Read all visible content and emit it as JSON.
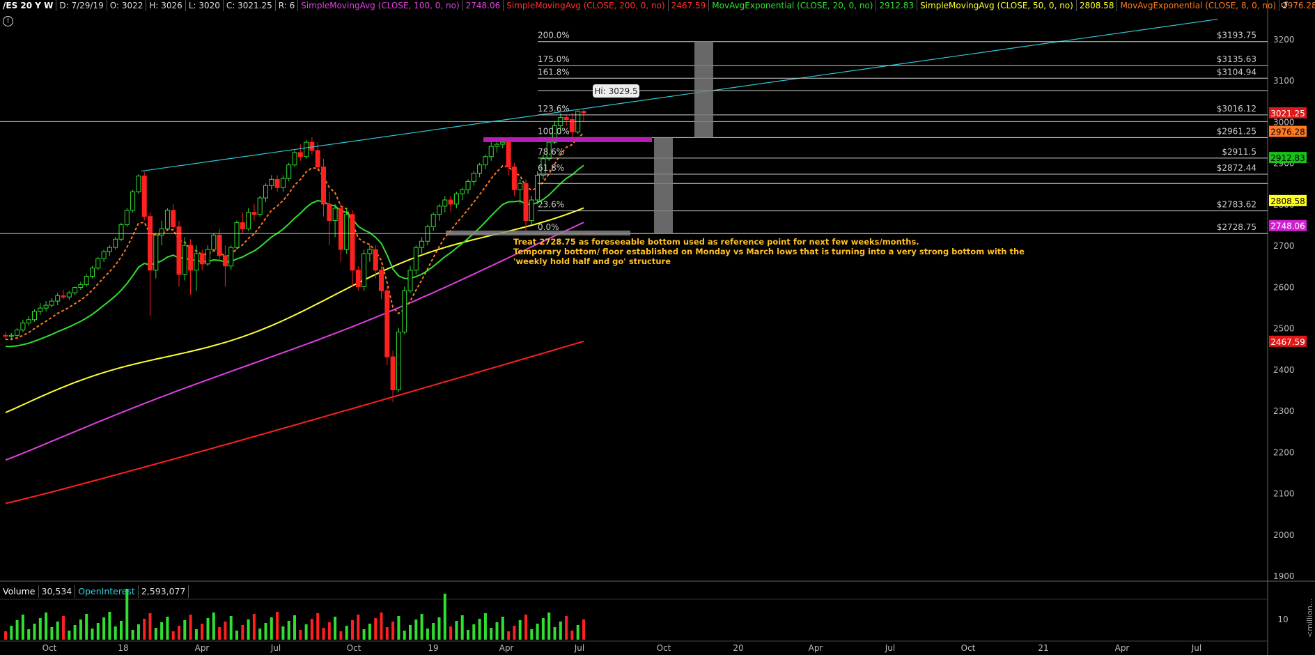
{
  "header": {
    "symbol": "/ES 20 Y W",
    "date": "D: 7/29/19",
    "open": "O: 3022",
    "high": "H: 3026",
    "low": "L: 3020",
    "close": "C: 3021.25",
    "range": "R: 6",
    "studies": [
      {
        "label": "SimpleMovingAvg (CLOSE, 100, 0, no)",
        "value": "2748.06",
        "color": "#e040e0"
      },
      {
        "label": "SimpleMovingAvg (CLOSE, 200, 0, no)",
        "value": "2467.59",
        "color": "#ff2020"
      },
      {
        "label": "MovAvgExponential (CLOSE, 20, 0, no)",
        "value": "2912.83",
        "color": "#30e030"
      },
      {
        "label": "SimpleMovingAvg (CLOSE, 50, 0, no)",
        "value": "2808.58",
        "color": "#ffff30"
      },
      {
        "label": "MovAvgExponential (CLOSE, 8, 0, no)",
        "value": "2976.28",
        "color": "#ff7a20"
      }
    ]
  },
  "annotation": {
    "lines": [
      "Treat 2728.75 as foreseeable bottom used as reference point for next few weeks/months.",
      "Temporary bottom/ floor established on Monday vs March lows that is turning into a very strong bottom with the",
      "'weekly hold half and go' structure"
    ],
    "color": "#ffc020"
  },
  "hi_bubble": "Hi: 3029.5",
  "volume_panel": {
    "volume_label": "Volume",
    "volume_value": "30,534",
    "oi_label": "OpenInterest",
    "oi_value": "2,593,077",
    "axis_unit": "<million...",
    "axis_tick": "10"
  },
  "chart_data": {
    "type": "candlestick",
    "instrument": "/ES",
    "timeframe": "weekly",
    "price_axis": {
      "range": [
        1865,
        3235
      ],
      "ticks": [
        3200,
        3100,
        3000,
        2900,
        2800,
        2700,
        2600,
        2500,
        2400,
        2300,
        2200,
        2100,
        2000,
        1900
      ]
    },
    "time_axis_labels": [
      "Oct",
      "18",
      "Apr",
      "Jul",
      "Oct",
      "19",
      "Apr",
      "Jul",
      "Oct",
      "20",
      "Apr",
      "Jul",
      "Oct",
      "21",
      "Apr",
      "Jul"
    ],
    "fibonacci": [
      {
        "level": "200.0%",
        "price": "$3193.75",
        "value": 3193.75
      },
      {
        "level": "175.0%",
        "price": "$3135.63",
        "value": 3135.63
      },
      {
        "level": "161.8%",
        "price": "$3104.94",
        "value": 3104.94
      },
      {
        "level": "",
        "price": "",
        "value": 3075
      },
      {
        "level": "123.6%",
        "price": "$3016.12",
        "value": 3016.12
      },
      {
        "level": "100.0%",
        "price": "$2961.25",
        "value": 2961.25
      },
      {
        "level": "78.6%",
        "price": "$2911.5",
        "value": 2911.5
      },
      {
        "level": "61.8%",
        "price": "$2872.44",
        "value": 2872.44
      },
      {
        "level": "",
        "price": "",
        "value": 2850
      },
      {
        "level": "23.6%",
        "price": "$2783.62",
        "value": 2783.62
      },
      {
        "level": "0.0%",
        "price": "$2728.75",
        "value": 2728.75
      }
    ],
    "price_labels": [
      {
        "text": "3021.25",
        "value": 3021.25,
        "bg": "#e01818",
        "fg": "#fff"
      },
      {
        "text": "2976.28",
        "value": 2976.28,
        "bg": "#ff7a20",
        "fg": "#000"
      },
      {
        "text": "2912.83",
        "value": 2912.83,
        "bg": "#18c018",
        "fg": "#000"
      },
      {
        "text": "2808.58",
        "value": 2808.58,
        "bg": "#ffff20",
        "fg": "#000"
      },
      {
        "text": "2748.06",
        "value": 2748.06,
        "bg": "#d020d0",
        "fg": "#fff"
      },
      {
        "text": "2467.59",
        "value": 2467.59,
        "bg": "#e01818",
        "fg": "#fff"
      }
    ],
    "ohlc": [
      [
        2482,
        2490,
        2472,
        2480
      ],
      [
        2480,
        2488,
        2470,
        2482
      ],
      [
        2482,
        2500,
        2478,
        2495
      ],
      [
        2495,
        2520,
        2490,
        2512
      ],
      [
        2512,
        2528,
        2505,
        2520
      ],
      [
        2520,
        2545,
        2515,
        2540
      ],
      [
        2540,
        2560,
        2532,
        2548
      ],
      [
        2548,
        2565,
        2540,
        2555
      ],
      [
        2555,
        2572,
        2550,
        2565
      ],
      [
        2565,
        2585,
        2555,
        2578
      ],
      [
        2578,
        2592,
        2570,
        2575
      ],
      [
        2575,
        2590,
        2568,
        2585
      ],
      [
        2585,
        2600,
        2580,
        2598
      ],
      [
        2598,
        2612,
        2592,
        2605
      ],
      [
        2605,
        2630,
        2600,
        2625
      ],
      [
        2625,
        2650,
        2620,
        2645
      ],
      [
        2645,
        2672,
        2640,
        2668
      ],
      [
        2668,
        2690,
        2660,
        2685
      ],
      [
        2685,
        2700,
        2675,
        2695
      ],
      [
        2695,
        2720,
        2690,
        2715
      ],
      [
        2715,
        2755,
        2710,
        2750
      ],
      [
        2750,
        2790,
        2745,
        2785
      ],
      [
        2785,
        2835,
        2780,
        2830
      ],
      [
        2830,
        2872,
        2825,
        2868
      ],
      [
        2868,
        2878,
        2760,
        2770
      ],
      [
        2770,
        2780,
        2530,
        2640
      ],
      [
        2640,
        2730,
        2620,
        2725
      ],
      [
        2725,
        2760,
        2700,
        2740
      ],
      [
        2740,
        2790,
        2735,
        2785
      ],
      [
        2785,
        2800,
        2735,
        2745
      ],
      [
        2745,
        2760,
        2600,
        2630
      ],
      [
        2630,
        2720,
        2615,
        2700
      ],
      [
        2700,
        2715,
        2580,
        2640
      ],
      [
        2640,
        2700,
        2590,
        2680
      ],
      [
        2680,
        2690,
        2640,
        2655
      ],
      [
        2655,
        2700,
        2650,
        2690
      ],
      [
        2690,
        2730,
        2685,
        2725
      ],
      [
        2725,
        2740,
        2660,
        2675
      ],
      [
        2675,
        2700,
        2600,
        2650
      ],
      [
        2650,
        2700,
        2640,
        2695
      ],
      [
        2695,
        2760,
        2690,
        2755
      ],
      [
        2755,
        2780,
        2730,
        2740
      ],
      [
        2740,
        2790,
        2735,
        2780
      ],
      [
        2780,
        2800,
        2760,
        2775
      ],
      [
        2775,
        2820,
        2770,
        2815
      ],
      [
        2815,
        2850,
        2805,
        2845
      ],
      [
        2845,
        2870,
        2835,
        2860
      ],
      [
        2860,
        2870,
        2830,
        2840
      ],
      [
        2840,
        2870,
        2830,
        2862
      ],
      [
        2862,
        2900,
        2855,
        2895
      ],
      [
        2895,
        2930,
        2890,
        2925
      ],
      [
        2925,
        2945,
        2905,
        2915
      ],
      [
        2915,
        2955,
        2910,
        2950
      ],
      [
        2950,
        2962,
        2920,
        2930
      ],
      [
        2930,
        2950,
        2880,
        2890
      ],
      [
        2890,
        2910,
        2770,
        2800
      ],
      [
        2800,
        2830,
        2700,
        2760
      ],
      [
        2760,
        2800,
        2720,
        2790
      ],
      [
        2790,
        2800,
        2660,
        2690
      ],
      [
        2690,
        2790,
        2680,
        2775
      ],
      [
        2775,
        2785,
        2600,
        2640
      ],
      [
        2640,
        2650,
        2590,
        2600
      ],
      [
        2600,
        2690,
        2590,
        2680
      ],
      [
        2680,
        2700,
        2660,
        2690
      ],
      [
        2690,
        2700,
        2620,
        2640
      ],
      [
        2640,
        2650,
        2570,
        2590
      ],
      [
        2590,
        2600,
        2410,
        2430
      ],
      [
        2430,
        2445,
        2320,
        2350
      ],
      [
        2350,
        2500,
        2345,
        2490
      ],
      [
        2490,
        2600,
        2485,
        2590
      ],
      [
        2590,
        2650,
        2585,
        2640
      ],
      [
        2640,
        2700,
        2630,
        2695
      ],
      [
        2695,
        2720,
        2680,
        2710
      ],
      [
        2710,
        2750,
        2700,
        2745
      ],
      [
        2745,
        2780,
        2735,
        2775
      ],
      [
        2775,
        2800,
        2760,
        2795
      ],
      [
        2795,
        2820,
        2780,
        2810
      ],
      [
        2810,
        2820,
        2780,
        2800
      ],
      [
        2800,
        2830,
        2790,
        2825
      ],
      [
        2825,
        2840,
        2810,
        2835
      ],
      [
        2835,
        2860,
        2825,
        2855
      ],
      [
        2855,
        2880,
        2845,
        2875
      ],
      [
        2875,
        2900,
        2865,
        2895
      ],
      [
        2895,
        2920,
        2885,
        2915
      ],
      [
        2915,
        2950,
        2905,
        2940
      ],
      [
        2940,
        2955,
        2925,
        2945
      ],
      [
        2945,
        2960,
        2935,
        2950
      ],
      [
        2950,
        2940,
        2870,
        2890
      ],
      [
        2890,
        2900,
        2820,
        2835
      ],
      [
        2835,
        2860,
        2800,
        2850
      ],
      [
        2850,
        2860,
        2735,
        2760
      ],
      [
        2760,
        2820,
        2750,
        2810
      ],
      [
        2810,
        2880,
        2800,
        2870
      ],
      [
        2870,
        2920,
        2860,
        2910
      ],
      [
        2910,
        2960,
        2905,
        2950
      ],
      [
        2950,
        3000,
        2945,
        2990
      ],
      [
        2990,
        3020,
        2970,
        3010
      ],
      [
        3010,
        3017,
        2990,
        3005
      ],
      [
        3005,
        3020,
        2960,
        2975
      ],
      [
        2975,
        3030,
        2970,
        3025
      ],
      [
        3025,
        3029.5,
        3000,
        3021.25
      ]
    ],
    "moving_averages": [
      {
        "name": "SMA 200",
        "color": "#ff2020",
        "start": 2075,
        "end": 2467.59
      },
      {
        "name": "SMA 100",
        "color": "#e040e0",
        "start": 2180,
        "end": 2748.06
      },
      {
        "name": "SMA 50",
        "color": "#ffff30",
        "start": 2295,
        "end": 2808.58
      },
      {
        "name": "EMA 20",
        "color": "#30e030",
        "start": 2420,
        "end": 2912.83
      },
      {
        "name": "EMA 8",
        "color": "#ff7a20",
        "start": 2440,
        "end": 2976.28
      }
    ]
  }
}
